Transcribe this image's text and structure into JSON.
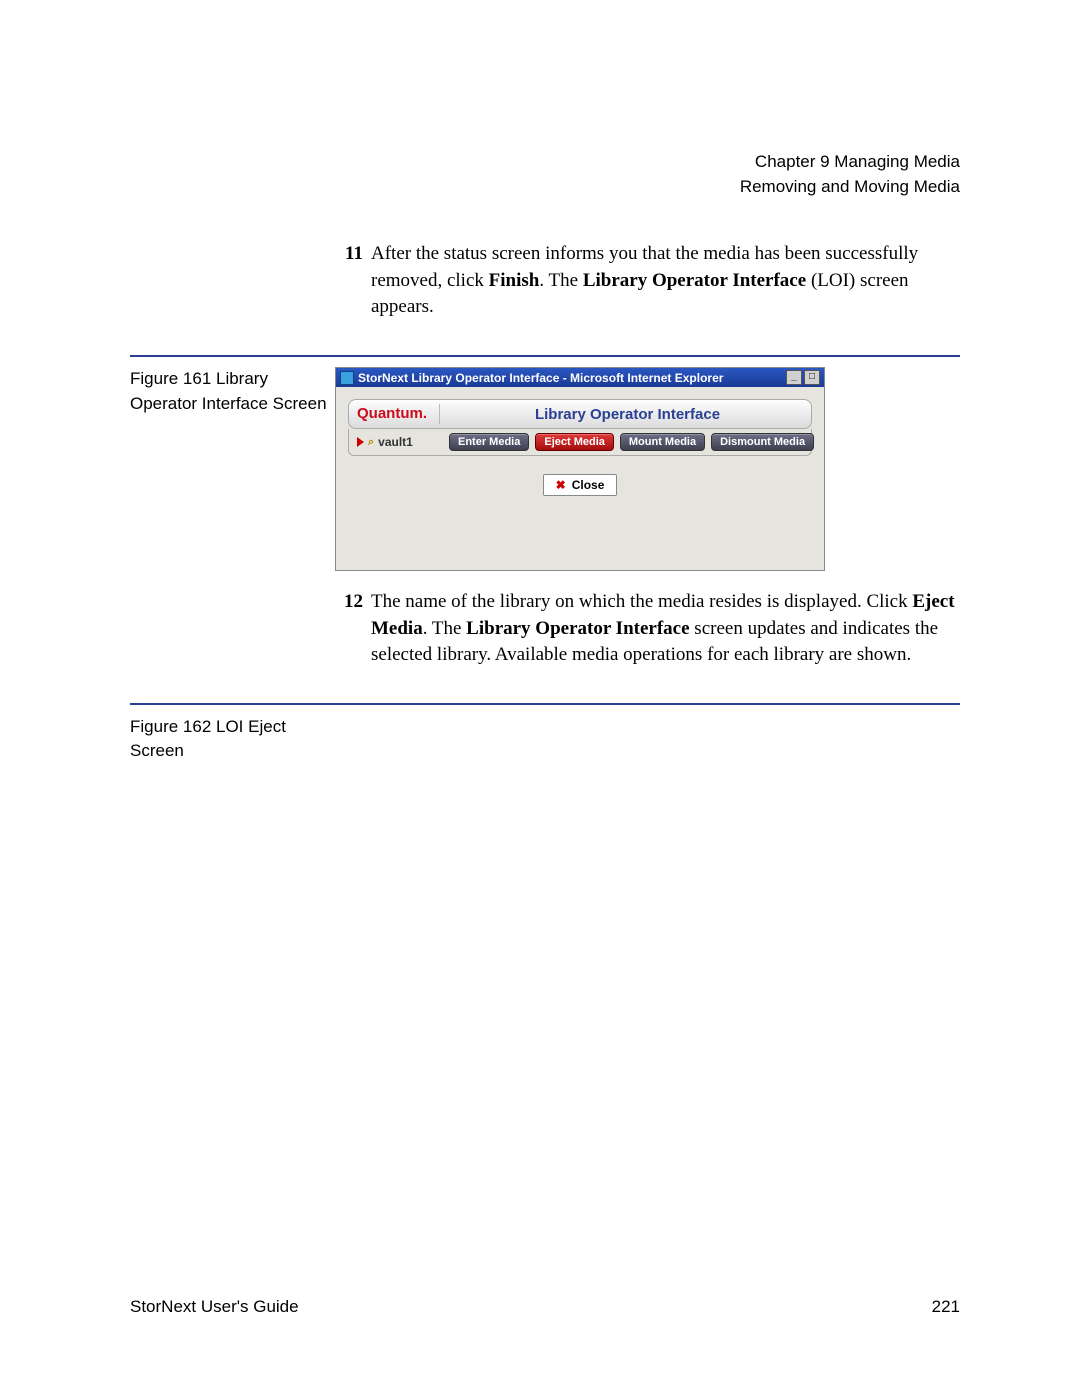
{
  "header": {
    "chapter": "Chapter 9  Managing Media",
    "section": "Removing and Moving Media"
  },
  "steps": {
    "s11": {
      "num": "11",
      "t1": "After the status screen informs you that the media has been successfully removed, click ",
      "b1": "Finish",
      "t2": ". The ",
      "b2": "Library Operator Interface",
      "t3": " (LOI) screen appears."
    },
    "s12": {
      "num": "12",
      "t1": "The name of the library on which the media resides is displayed. Click ",
      "b1": "Eject Media",
      "t2": ". The ",
      "b2": "Library Operator Interface",
      "t3": " screen updates and indicates the selected library. Available media operations for each library are shown."
    }
  },
  "figures": {
    "f161": "Figure 161  Library Operator Interface Screen",
    "f162": "Figure 162  LOI Eject Screen"
  },
  "embed": {
    "window_title": "StorNext Library Operator Interface - Microsoft Internet Explorer",
    "brand": "Quantum",
    "title": "Library Operator Interface",
    "vault": "vault1",
    "buttons": {
      "enter": "Enter Media",
      "eject": "Eject Media",
      "mount": "Mount Media",
      "dismount": "Dismount Media"
    },
    "close": "Close"
  },
  "footer": {
    "left": "StorNext User's Guide",
    "right": "221"
  }
}
